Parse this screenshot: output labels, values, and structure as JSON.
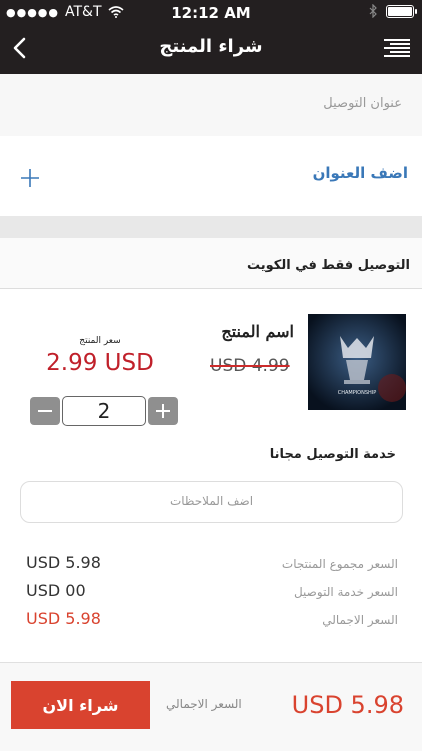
{
  "status_bar": {
    "carrier": "AT&T",
    "time": "12:12 AM"
  },
  "nav": {
    "title": "شراء المنتج"
  },
  "address": {
    "label": "عنوان التوصيل",
    "add_label": "اضف العنوان"
  },
  "delivery_note": "التوصيل فقط في الكويت",
  "product": {
    "name": "اسم المنتج",
    "old_price": "USD 4.99",
    "price_label": "سعر المنتج",
    "price": "2.99 USD",
    "quantity": "2",
    "image_text": "CHAMPIONSHIP"
  },
  "free_service": "خدمة التوصيل مجانا",
  "notes_placeholder": "اضف الملاحظات",
  "summary": [
    {
      "label": "السعر مجموع المنتجات",
      "amount": "USD 5.98"
    },
    {
      "label": "السعر خدمة التوصيل",
      "amount": "USD 00"
    },
    {
      "label": "السعر الاجمالي",
      "amount": "USD 5.98"
    }
  ],
  "footer": {
    "buy_label": "شراء الان",
    "total_label": "السعر الاجمالي",
    "total": "USD 5.98"
  },
  "colors": {
    "accent": "#d9432f",
    "price": "#c0202a",
    "link": "#3a78b8",
    "bar": "#231f20"
  }
}
